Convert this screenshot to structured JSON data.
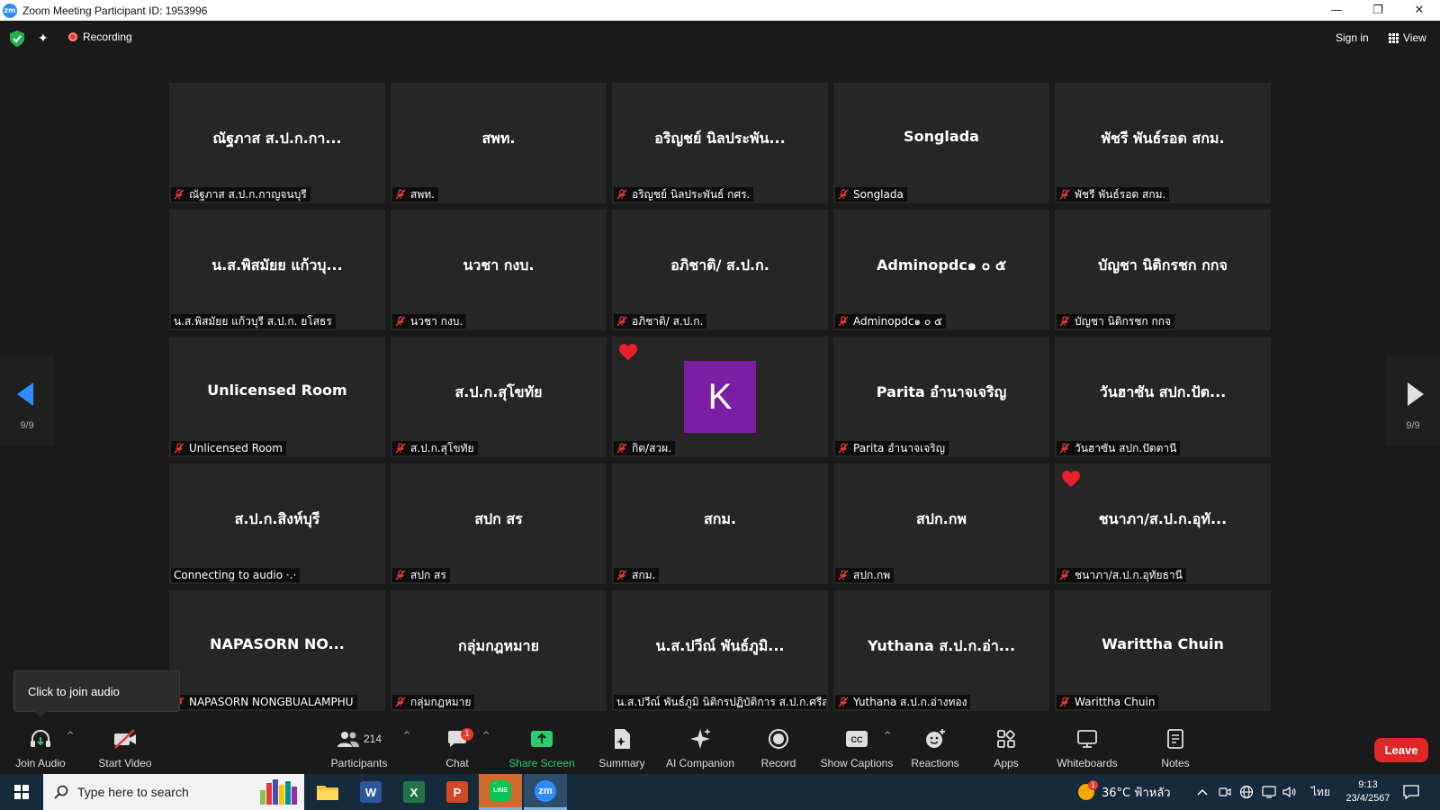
{
  "window": {
    "title": "Zoom Meeting Participant ID: 1953996",
    "logo_text": "zm",
    "minimize": "—",
    "restore": "❐",
    "close": "✕"
  },
  "topbar": {
    "recording_label": "Recording",
    "signin_label": "Sign in",
    "view_label": "View"
  },
  "pagination": {
    "left_page": "9/9",
    "right_page": "9/9"
  },
  "tiles": [
    {
      "name": "ณัฐภาส ส.ป.ก.กา...",
      "label": "ณัฐภาส ส.ป.ก.กาญจนบุรี",
      "muted": true
    },
    {
      "name": "สพท.",
      "label": "สพท.",
      "muted": true
    },
    {
      "name": "อริญชย์ นิลประพัน...",
      "label": "อริญชย์ นิลประพันธ์ กศร.",
      "muted": true
    },
    {
      "name": "Songlada",
      "label": "Songlada",
      "muted": true
    },
    {
      "name": "พัชรี พันธ์รอด สกม.",
      "label": "พัชรี พันธ์รอด สกม.",
      "muted": true
    },
    {
      "name": "น.ส.พิสมัยย แก้วบุ...",
      "label": "น.ส.พิสมัยย แก้วบุรี ส.ป.ก. ยโสธร",
      "muted": false
    },
    {
      "name": "นวชา กงบ.",
      "label": "นวชา กงบ.",
      "muted": true
    },
    {
      "name": "อภิชาติ/ ส.ป.ก.",
      "label": "อภิชาติ/ ส.ป.ก.",
      "muted": true
    },
    {
      "name": "Adminopdc๑ ๐ ๕",
      "label": "Adminopdc๑ ๐ ๕",
      "muted": true
    },
    {
      "name": "บัญชา นิติกรชก กกจ",
      "label": "บัญชา นิติกรชก กกจ",
      "muted": true
    },
    {
      "name": "Unlicensed Room",
      "label": "Unlicensed Room",
      "muted": true
    },
    {
      "name": "ส.ป.ก.สุโขทัย",
      "label": "ส.ป.ก.สุโขทัย",
      "muted": true
    },
    {
      "name": "",
      "avatar": "K",
      "heart": true,
      "label": "กิต/สวผ.",
      "muted": true
    },
    {
      "name": "Parita อำนาจเจริญ",
      "label": "Parita อำนาจเจริญ",
      "muted": true
    },
    {
      "name": "วันฮาซัน สปก.ปัต...",
      "label": "วันฮาซัน สปก.ปัตตานี",
      "muted": true
    },
    {
      "name": "ส.ป.ก.สิงห์บุรี",
      "label": "Connecting to audio ·.·",
      "muted": false
    },
    {
      "name": "สปก สร",
      "label": "สปก สร",
      "muted": true
    },
    {
      "name": "สกม.",
      "label": "สกม.",
      "muted": true
    },
    {
      "name": "สปก.กพ",
      "label": "สปก.กพ",
      "muted": true
    },
    {
      "name": "ชนาภา/ส.ป.ก.อุทั...",
      "heart": true,
      "label": "ชนาภา/ส.ป.ก.อุทัยธานี",
      "muted": true
    },
    {
      "name": "NAPASORN  NO...",
      "label": "NAPASORN NONGBUALAMPHU",
      "muted": true
    },
    {
      "name": "กลุ่มกฎหมาย",
      "label": "กลุ่มกฎหมาย",
      "muted": true
    },
    {
      "name": "น.ส.ปวีณ์ พันธ์ภูมิ...",
      "label": "น.ส.ปวีณ์ พันธ์ภูมิ นิติกรปฏิบัติการ ส.ป.ก.ศรีส...",
      "muted": false
    },
    {
      "name": "Yuthana ส.ป.ก.อ่า...",
      "label": "Yuthana ส.ป.ก.อ่างทอง",
      "muted": true
    },
    {
      "name": "Warittha Chuin",
      "label": "Warittha Chuin",
      "muted": true
    }
  ],
  "tooltip": {
    "text": "Click to join audio"
  },
  "toolbar": {
    "join_audio": "Join Audio",
    "start_video": "Start Video",
    "participants": "Participants",
    "participants_count": "214",
    "chat": "Chat",
    "chat_badge": "1",
    "share_screen": "Share Screen",
    "summary": "Summary",
    "ai_companion": "AI Companion",
    "record": "Record",
    "show_captions": "Show Captions",
    "reactions": "Reactions",
    "apps": "Apps",
    "whiteboards": "Whiteboards",
    "notes": "Notes",
    "leave": "Leave",
    "caret": "^"
  },
  "taskbar": {
    "search_placeholder": "Type here to search",
    "weather": "36°C ฟ้าหลัว",
    "weather_badge": "1",
    "language": "ไทย",
    "time": "9:13",
    "date": "23/4/2567",
    "word_letter": "W",
    "excel_letter": "X",
    "ppt_letter": "P",
    "line_label": "LINE",
    "zoom_letter": "zm"
  },
  "colors": {
    "zoom_blue": "#2d8cff",
    "leave_red": "#e02828",
    "tile_bg": "#262626",
    "share_green": "#2ecc71",
    "avatar_purple": "#7b1fa2",
    "muted_red": "#e53935"
  }
}
